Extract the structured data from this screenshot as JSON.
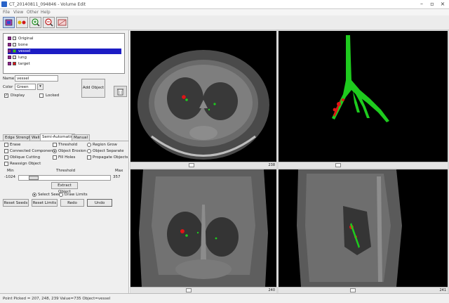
{
  "window": {
    "title": "CT_20140811_094846 - Volume Edit"
  },
  "menubar": [
    "File",
    "View",
    "Other",
    "Help"
  ],
  "objects": [
    {
      "name": "Original",
      "color": "#ffffff"
    },
    {
      "name": "bone",
      "color": "#ffffff"
    },
    {
      "name": "vessel",
      "color": "#1ecb1e",
      "selected": true
    },
    {
      "name": "lung",
      "color": "#e2e2e2"
    },
    {
      "name": "target",
      "color": "#e01515"
    }
  ],
  "props": {
    "name_label": "Name",
    "name_value": "vessel",
    "color_label": "Color",
    "color_value": "Green",
    "display_label": "Display",
    "locked_label": "Locked",
    "add_object": "Add Object"
  },
  "tabs": [
    "Edge Strength",
    "Walls",
    "Semi-Automatic",
    "Manual"
  ],
  "options": [
    {
      "label": "Erase",
      "type": "check"
    },
    {
      "label": "Connected Component",
      "type": "check"
    },
    {
      "label": "Oblique Cutting",
      "type": "check"
    },
    {
      "label": "Reassign Object",
      "type": "check"
    },
    {
      "label": "Threshold",
      "type": "check"
    },
    {
      "label": "Object Erosion",
      "type": "radio",
      "on": true
    },
    {
      "label": "Fill Holes",
      "type": "check"
    },
    {
      "label": "Region Grow",
      "type": "radio"
    },
    {
      "label": "Object Separate",
      "type": "radio"
    },
    {
      "label": "Propagate Objects",
      "type": "check"
    }
  ],
  "threshold": {
    "min_label": "Min",
    "mid_label": "Threshold",
    "max_label": "Max",
    "min_value": "-1024",
    "max_value": "357",
    "fraction": 0.12,
    "extract": "Extract Object"
  },
  "seeds": {
    "select_seed": "Select Seeds",
    "draw_limit": "Draw Limits"
  },
  "bottom_buttons": [
    "Reset Seeds",
    "Reset Limits",
    "Redo",
    "Undo"
  ],
  "views": {
    "axial_num": "238",
    "coronal_num": "240",
    "sagittal_num": "241",
    "axial_slider": 0.42,
    "render_slider": 0.35,
    "coronal_slider": 0.4,
    "sagittal_slider": 0.44
  },
  "status": "Point Picked = 207, 248, 239 Value=735 Object=vessel"
}
